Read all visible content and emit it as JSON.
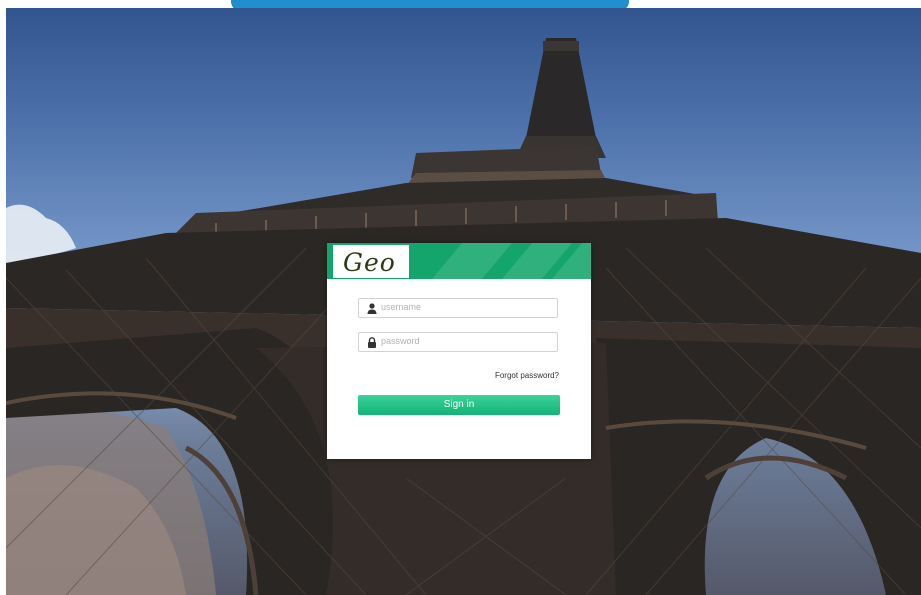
{
  "brand": {
    "logo_text": "Geo",
    "accent_color": "#13a56c",
    "top_bar_color": "#1f8fd0"
  },
  "login": {
    "username_placeholder": "username",
    "password_placeholder": "password",
    "forgot_label": "Forgot password?",
    "signin_label": "Sign in",
    "username_icon": "user-icon",
    "password_icon": "lock-icon"
  },
  "background": {
    "subject": "eiffel-tower-photo"
  }
}
